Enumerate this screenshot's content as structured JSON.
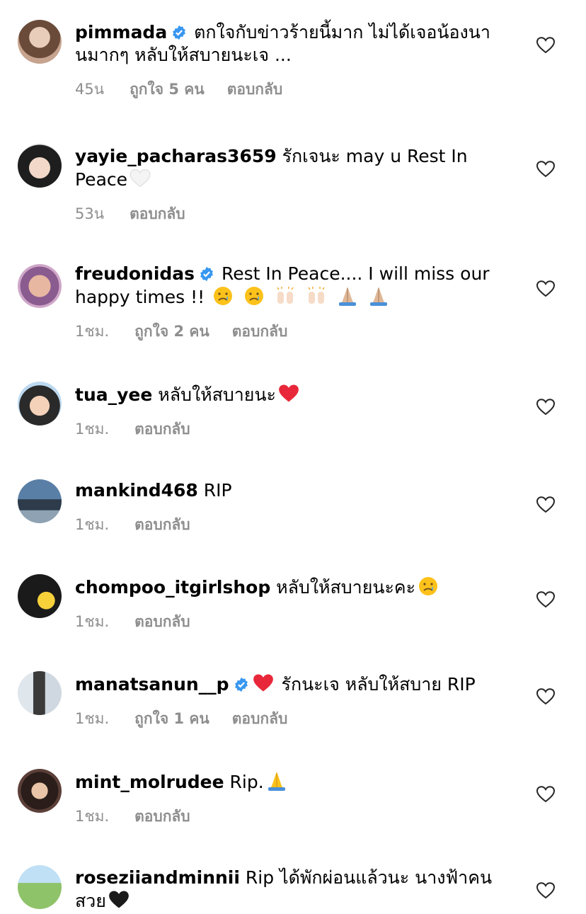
{
  "comments": [
    {
      "username": "pimmada",
      "verified": true,
      "line1": " ตกใจกับข่าวร้ายนี้มาก ไม่ได้เจอน้องนา",
      "line2": "นมากๆ หลับให้สบายนะเจ ...",
      "time": "45น",
      "likes": "ถูกใจ 5 คน",
      "reply": "ตอบกลับ"
    },
    {
      "username": "yayie_pacharas3659",
      "verified": false,
      "line1": " รักเจนะ may u Rest In",
      "line2": "Peace",
      "time": "53น",
      "likes": "",
      "reply": "ตอบกลับ"
    },
    {
      "username": "freudonidas",
      "verified": true,
      "line1": " Rest In Peace.... I will miss our",
      "line2": "happy times !!",
      "time": "1ชม.",
      "likes": "ถูกใจ 2 คน",
      "reply": "ตอบกลับ"
    },
    {
      "username": "tua_yee",
      "verified": false,
      "line1": " หลับให้สบายนะ",
      "line2": "",
      "time": "1ชม.",
      "likes": "",
      "reply": "ตอบกลับ"
    },
    {
      "username": "mankind468",
      "verified": false,
      "line1": " RIP",
      "line2": "",
      "time": "1ชม.",
      "likes": "",
      "reply": "ตอบกลับ"
    },
    {
      "username": "chompoo_itgirlshop",
      "verified": false,
      "line1": " หลับให้สบายนะคะ",
      "line2": "",
      "time": "1ชม.",
      "likes": "",
      "reply": "ตอบกลับ"
    },
    {
      "username": "manatsanun__p",
      "verified": true,
      "line1": "  รักนะเจ หลับให้สบาย RIP",
      "line2": "",
      "time": "1ชม.",
      "likes": "ถูกใจ 1 คน",
      "reply": "ตอบกลับ"
    },
    {
      "username": "mint_molrudee",
      "verified": false,
      "line1": " Rip.",
      "line2": "",
      "time": "1ชม.",
      "likes": "",
      "reply": "ตอบกลับ"
    },
    {
      "username": "roseziiandminnii",
      "verified": false,
      "line1": " Rip ได้พักผ่อนแล้วนะ นางฟ้าคน",
      "line2": "สวย",
      "time": "",
      "likes": "",
      "reply": ""
    }
  ],
  "colors": {
    "verified": "#3897f0",
    "meta": "#8e8e8e",
    "heart_red": "#e8283a"
  }
}
